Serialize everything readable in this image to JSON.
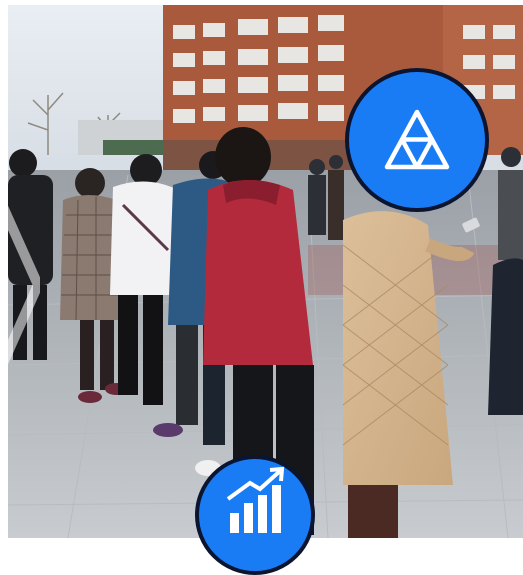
{
  "photo": {
    "scene": "outdoor-queue"
  },
  "overlays": {
    "badge_fill": "#1a7cf5",
    "badge_border": "#0b1530",
    "top_badge_icon": "triangle-icon",
    "bottom_badge_icon": "growth-chart-icon"
  }
}
